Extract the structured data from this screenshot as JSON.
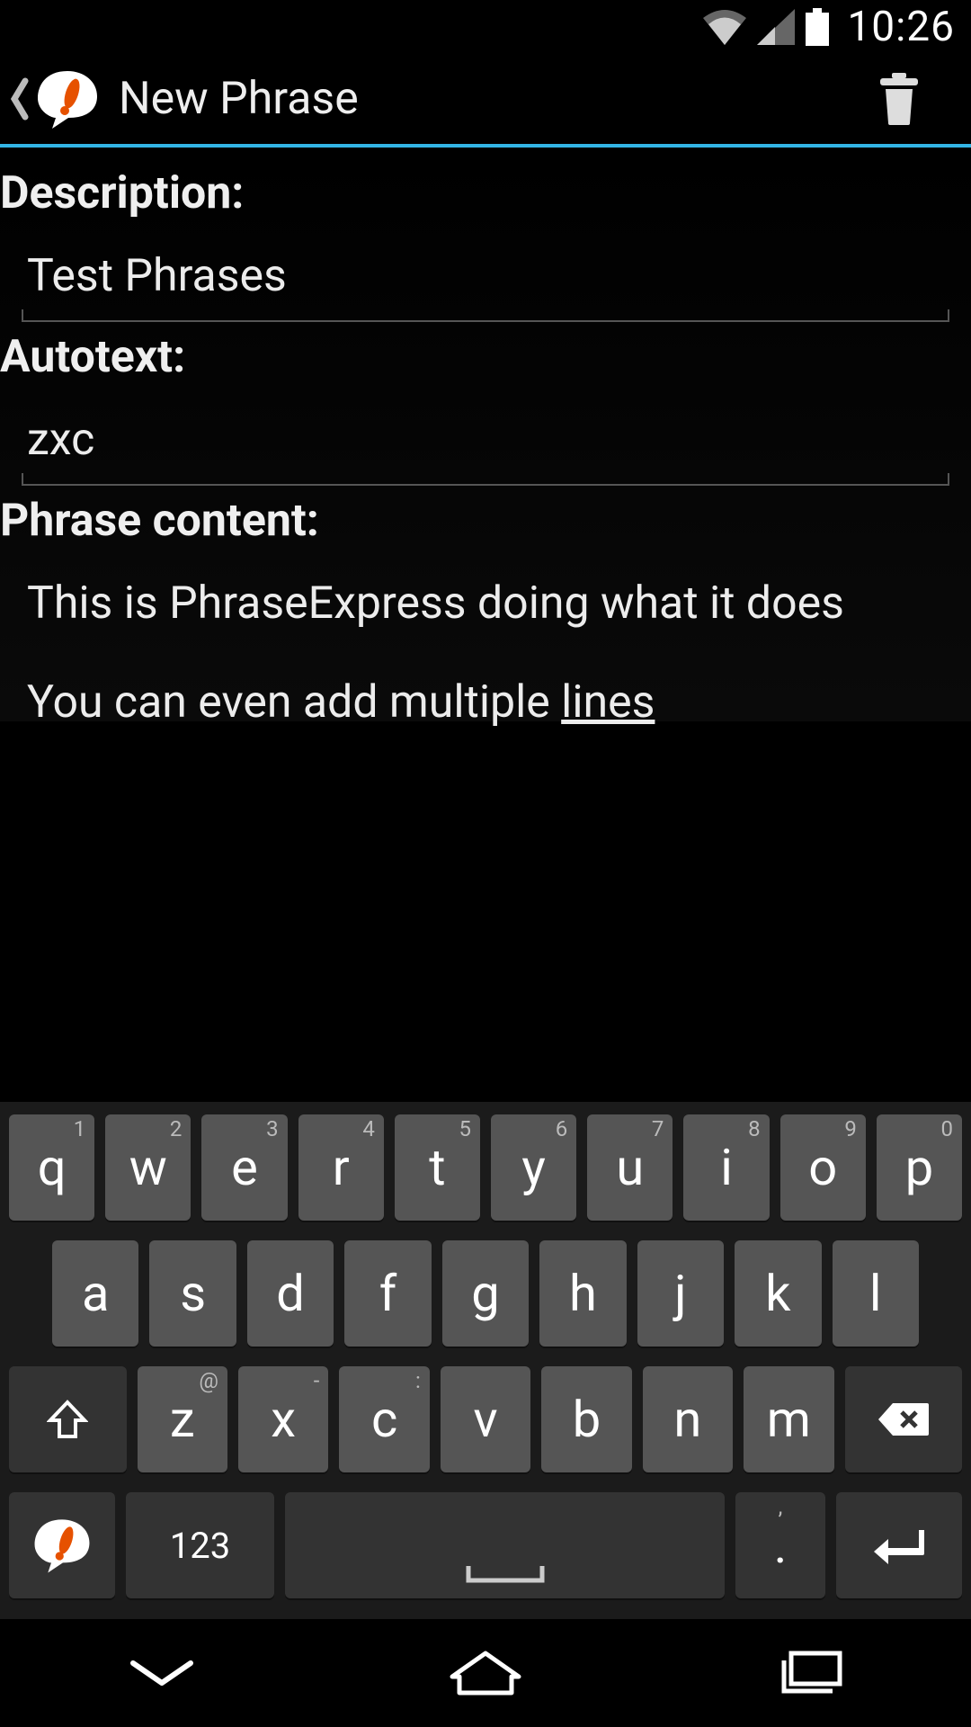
{
  "status": {
    "time": "10:26"
  },
  "header": {
    "title": "New Phrase"
  },
  "form": {
    "description_label": "Description:",
    "description_value": "Test Phrases",
    "autotext_label": "Autotext:",
    "autotext_value": "zxc",
    "phrase_label": "Phrase content:",
    "phrase_line1": "This is PhraseExpress doing what it does",
    "phrase_line2_prefix": "You can even add multiple ",
    "phrase_line2_underlined": "lines"
  },
  "keyboard": {
    "row1": [
      {
        "main": "q",
        "sup": "1"
      },
      {
        "main": "w",
        "sup": "2"
      },
      {
        "main": "e",
        "sup": "3"
      },
      {
        "main": "r",
        "sup": "4"
      },
      {
        "main": "t",
        "sup": "5"
      },
      {
        "main": "y",
        "sup": "6"
      },
      {
        "main": "u",
        "sup": "7"
      },
      {
        "main": "i",
        "sup": "8"
      },
      {
        "main": "o",
        "sup": "9"
      },
      {
        "main": "p",
        "sup": "0"
      }
    ],
    "row2": [
      {
        "main": "a"
      },
      {
        "main": "s"
      },
      {
        "main": "d"
      },
      {
        "main": "f"
      },
      {
        "main": "g"
      },
      {
        "main": "h"
      },
      {
        "main": "j"
      },
      {
        "main": "k"
      },
      {
        "main": "l"
      }
    ],
    "row3": [
      {
        "main": "z",
        "sup": "@"
      },
      {
        "main": "x",
        "sup": "-"
      },
      {
        "main": "c",
        "sup": ":"
      },
      {
        "main": "v"
      },
      {
        "main": "b"
      },
      {
        "main": "n"
      },
      {
        "main": "m"
      }
    ],
    "numeric_label": "123",
    "period_main": ".",
    "period_sup": ","
  }
}
